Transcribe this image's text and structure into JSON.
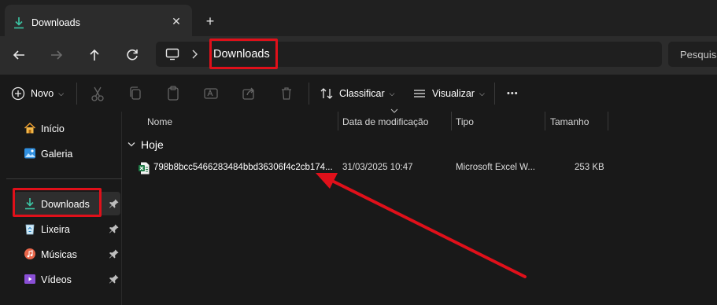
{
  "tab": {
    "label": "Downloads",
    "close": "✕",
    "new": "+"
  },
  "address": {
    "path": "Downloads"
  },
  "search": {
    "placeholder": "Pesquisar"
  },
  "commands": {
    "new_label": "Novo",
    "sort_label": "Classificar",
    "view_label": "Visualizar",
    "more": "•••"
  },
  "sidebar": {
    "items": [
      {
        "label": "Início",
        "icon": "home-icon"
      },
      {
        "label": "Galeria",
        "icon": "gallery-icon"
      },
      {
        "label": "Downloads",
        "icon": "download-icon",
        "pinned": true,
        "selected": true
      },
      {
        "label": "Lixeira",
        "icon": "recycle-bin-icon",
        "pinned": true
      },
      {
        "label": "Músicas",
        "icon": "music-icon",
        "pinned": true
      },
      {
        "label": "Vídeos",
        "icon": "video-icon",
        "pinned": true
      }
    ]
  },
  "columns": [
    "Nome",
    "Data de modificação",
    "Tipo",
    "Tamanho"
  ],
  "groups": [
    {
      "label": "Hoje",
      "files": [
        {
          "name": "798b8bcc5466283484bbd36306f4c2cb174...",
          "modified": "31/03/2025 10:47",
          "type": "Microsoft Excel W...",
          "size": "253 KB",
          "icon": "excel-file-icon"
        }
      ]
    }
  ],
  "colors": {
    "accent_green": "#3cc6a5",
    "highlight_red": "#e0101a",
    "excel_green": "#1d7a45"
  }
}
